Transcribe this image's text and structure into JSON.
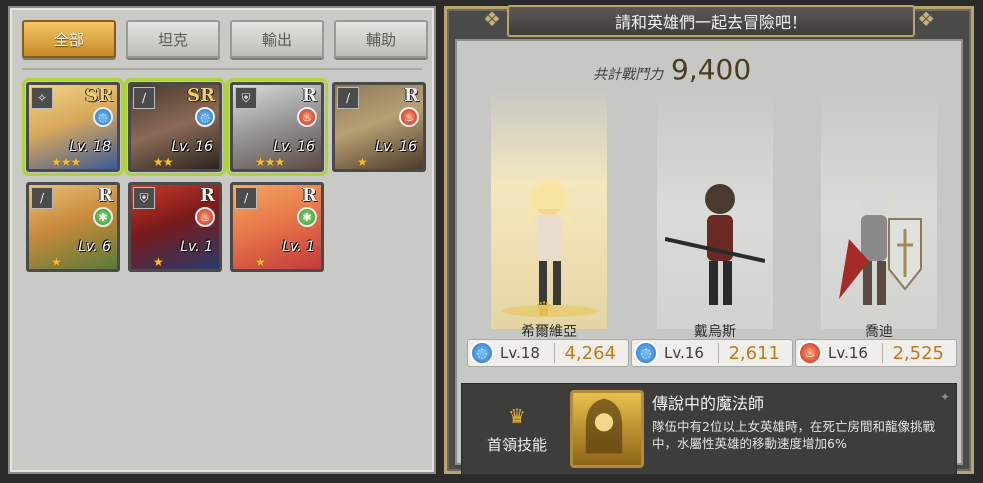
{
  "tabs": [
    {
      "label": "全部",
      "active": true
    },
    {
      "label": "坦克",
      "active": false
    },
    {
      "label": "輸出",
      "active": false
    },
    {
      "label": "輔助",
      "active": false
    }
  ],
  "hero_cards": [
    {
      "class_icon": "staff-icon",
      "rarity": "SR",
      "element": "water",
      "level": "Lv. 18",
      "stars": "★★★",
      "selected": true
    },
    {
      "class_icon": "sword-icon",
      "rarity": "SR",
      "element": "water",
      "level": "Lv. 16",
      "stars": "★★",
      "selected": true
    },
    {
      "class_icon": "shield-icon",
      "rarity": "R",
      "element": "fire",
      "level": "Lv. 16",
      "stars": "★★★",
      "selected": true
    },
    {
      "class_icon": "sword-icon",
      "rarity": "R",
      "element": "fire",
      "level": "Lv. 16",
      "stars": "★",
      "selected": false
    },
    {
      "class_icon": "sword-icon",
      "rarity": "R",
      "element": "wind",
      "level": "Lv. 6",
      "stars": "★",
      "selected": false
    },
    {
      "class_icon": "shield-icon",
      "rarity": "R",
      "element": "fire",
      "level": "Lv. 1",
      "stars": "★",
      "selected": false
    },
    {
      "class_icon": "sword-icon",
      "rarity": "R",
      "element": "wind",
      "level": "Lv. 1",
      "stars": "★",
      "selected": false
    }
  ],
  "banner_title": "請和英雄們一起去冒險吧！",
  "total_power": {
    "label": "共計戰鬥力",
    "value": "9,400"
  },
  "party": [
    {
      "name": "希爾維亞",
      "element": "water",
      "level": "Lv.18",
      "power": "4,264",
      "leader": true
    },
    {
      "name": "戴烏斯",
      "element": "water",
      "level": "Lv.16",
      "power": "2,611",
      "leader": false
    },
    {
      "name": "喬迪",
      "element": "fire",
      "level": "Lv.16",
      "power": "2,525",
      "leader": false
    }
  ],
  "leader_skill": {
    "label": "首領技能",
    "name": "傳說中的魔法師",
    "description": "隊伍中有2位以上女英雄時，在死亡房間和龍像挑戰中，水屬性英雄的移動速度增加6%"
  },
  "colors": {
    "accent_gold": "#c78a28",
    "select_green": "#aed23a",
    "power_gold": "#c07a18"
  }
}
